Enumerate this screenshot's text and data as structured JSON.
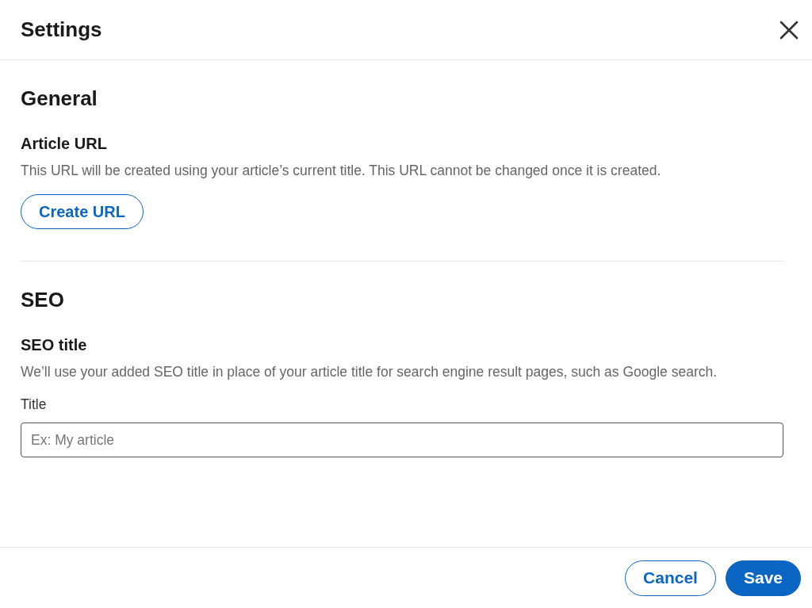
{
  "dialog": {
    "title": "Settings"
  },
  "sections": [
    {
      "heading": "General",
      "fields": [
        {
          "kind": "button",
          "label": "Article URL",
          "description": "This URL will be created using your article’s current title. This URL cannot be changed once it is created.",
          "button": "Create URL"
        }
      ]
    },
    {
      "heading": "SEO",
      "fields": [
        {
          "kind": "input",
          "label": "SEO title",
          "description": "We’ll use your added SEO title in place of your article title for search engine result pages, such as Google search.",
          "input_label": "Title",
          "placeholder": "Ex: My article"
        }
      ]
    }
  ],
  "footer": {
    "buttons": [
      {
        "label": "Cancel",
        "kind": "secondary"
      },
      {
        "label": "Save",
        "kind": "primary"
      }
    ]
  }
}
